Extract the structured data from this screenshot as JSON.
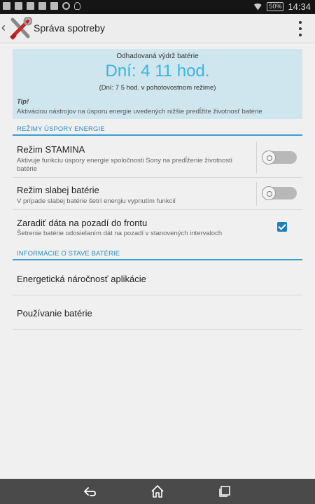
{
  "status_bar": {
    "battery": "50%",
    "time": "14:34",
    "icons": [
      "image-icon",
      "screenshot-icon",
      "video-icon",
      "mail-icon",
      "facebook-icon",
      "sync-icon",
      "bulb-icon",
      "wifi-icon",
      "battery-icon"
    ]
  },
  "action_bar": {
    "title": "Správa spotreby",
    "icon": "tools-icon"
  },
  "estimate": {
    "label": "Odhadovaná výdrž batérie",
    "value": "Dní: 4 11 hod.",
    "standby": "(Dní: 7 5 hod. v pohotovostnom režime)",
    "tip_title": "Tip!",
    "tip_text": "Aktiváciou nástrojov na úsporu energie uvedených nižšie predĺžite životnosť batérie"
  },
  "sections": {
    "modes": "REŽIMY ÚSPORY ENERGIE",
    "info": "INFORMÁCIE O STAVE BATÉRIE"
  },
  "modes": [
    {
      "title": "Režim STAMINA",
      "subtitle": "Aktivuje funkciu úspory energie spoločnosti Sony na predĺženie životnosti batérie",
      "control": "toggle",
      "on": false
    },
    {
      "title": "Režim slabej batérie",
      "subtitle": "V prípade slabej batérie šetrí energiu vypnutím funkcií",
      "control": "toggle",
      "on": false
    },
    {
      "title": "Zaradiť dáta na pozadí do frontu",
      "subtitle": "Šetrenie batérie odosielaním dát na pozadí v stanovených intervaloch",
      "control": "checkbox",
      "checked": true
    }
  ],
  "info_items": [
    {
      "title": "Energetická náročnosť aplikácie"
    },
    {
      "title": "Používanie batérie"
    }
  ],
  "colors": {
    "accent": "#3ab4e0",
    "section": "#2a8fc0",
    "card_bg": "#cfe6ee",
    "checkbox": "#1f7fc0"
  }
}
